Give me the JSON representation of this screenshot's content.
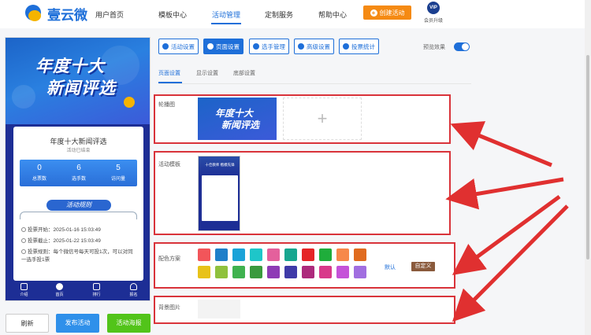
{
  "nav": {
    "logo_text": "壹云微",
    "items": [
      {
        "label": "用户首页"
      },
      {
        "label": "模板中心"
      },
      {
        "label": "活动管理"
      },
      {
        "label": "定制服务"
      },
      {
        "label": "帮助中心"
      }
    ],
    "create_label": "创建活动",
    "vip_badge": "VIP",
    "vip_label": "会员升级"
  },
  "phone": {
    "banner_line1": "年度十大",
    "banner_line2": "新闻评选",
    "title": "年度十大新闻评选",
    "status": "活动已结束",
    "stats": [
      {
        "value": "0",
        "label": "总票数"
      },
      {
        "value": "6",
        "label": "选手数"
      },
      {
        "value": "5",
        "label": "访问量"
      }
    ],
    "rules_button": "活动规则",
    "info": [
      {
        "label": "投票开始：",
        "value": "2025-01-16 15:03:49"
      },
      {
        "label": "投票截止：",
        "value": "2025-01-22 15:03:49"
      },
      {
        "label": "投票规则：",
        "value": "每个微信号每天可投1次，可以对同一选手投1票"
      }
    ],
    "tabs": [
      {
        "label": "介绍"
      },
      {
        "label": "首页"
      },
      {
        "label": "排行"
      },
      {
        "label": "报名"
      }
    ]
  },
  "actions": {
    "refresh": "刷新",
    "publish": "发布活动",
    "poster": "活动海报"
  },
  "toolbar": [
    {
      "label": "活动设置"
    },
    {
      "label": "页面设置"
    },
    {
      "label": "选手管理"
    },
    {
      "label": "高级设置"
    },
    {
      "label": "投票统计"
    }
  ],
  "preview_label": "预览效果",
  "subtabs": [
    {
      "label": "页面设置"
    },
    {
      "label": "显示设置"
    },
    {
      "label": "底部设置"
    }
  ],
  "sections": {
    "carousel_label": "轮播图",
    "carousel_img_line1": "年度十大",
    "carousel_img_line2": "新闻评选",
    "carousel_add": "+",
    "template_label": "活动模板",
    "template_thumb_title": "十佳教师 楷模先锋",
    "color_label": "配色方案",
    "default_label": "默认",
    "custom_label": "自定义",
    "bg_label": "背景图片"
  },
  "colors": {
    "accent": "#1e6fd9",
    "orange": "#f58a13",
    "highlight_border": "#d9333a",
    "arrow": "#e03030",
    "publish_button": "#2f90ea",
    "poster_button": "#52c41a",
    "swatches_row1": [
      "#f2555a",
      "#1f7fc9",
      "#1aa3d8",
      "#1ec6c9",
      "#e4609c",
      "#17a68f",
      "#e52527",
      "#1fad3b",
      "#f7884a",
      "#e06b1f"
    ],
    "swatches_row2": [
      "#e8c219",
      "#8fc13d",
      "#3fb24f",
      "#3a9a3e",
      "#8e3bb5",
      "#3f3aa8",
      "#ad2a7c",
      "#d8398a",
      "#c552d8",
      "#a16ee0"
    ]
  }
}
